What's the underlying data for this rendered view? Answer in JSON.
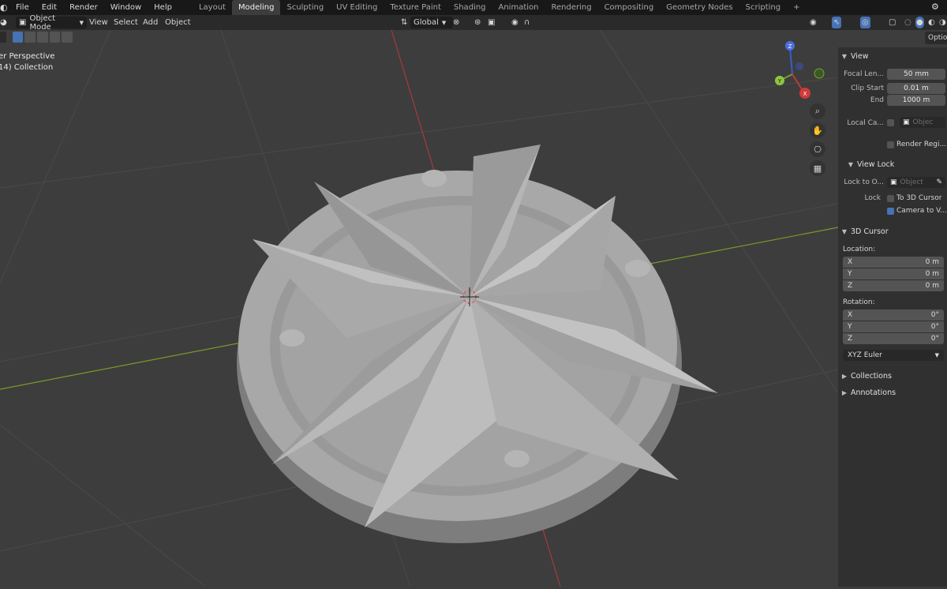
{
  "menu": [
    "File",
    "Edit",
    "Render",
    "Window",
    "Help"
  ],
  "workspaces": [
    "Layout",
    "Modeling",
    "Sculpting",
    "UV Editing",
    "Texture Paint",
    "Shading",
    "Animation",
    "Rendering",
    "Compositing",
    "Geometry Nodes",
    "Scripting"
  ],
  "active_workspace": "Modeling",
  "add_workspace": "+",
  "header": {
    "mode": "Object Mode",
    "view": "View",
    "select": "Select",
    "add": "Add",
    "object": "Object",
    "orientation": "Global"
  },
  "viewport": {
    "perspective_label": "er Perspective",
    "collection_label": "14) Collection"
  },
  "gizmo": {
    "x": "X",
    "y": "Y",
    "z": "Z"
  },
  "options_tab": "Optio",
  "npanel": {
    "view": {
      "title": "View",
      "focal_label": "Focal Len...",
      "focal_value": "50 mm",
      "clip_start_label": "Clip Start",
      "clip_start_value": "0.01 m",
      "end_label": "End",
      "end_value": "1000 m",
      "local_camera_label": "Local Ca...",
      "local_camera_placeholder": "Objec",
      "render_region_label": "Render Regi..."
    },
    "view_lock": {
      "title": "View Lock",
      "lock_to_object_label": "Lock to O...",
      "lock_to_object_placeholder": "Object",
      "lock_label": "Lock",
      "to_3d_cursor_label": "To 3D Cursor",
      "camera_to_view_label": "Camera to V..."
    },
    "cursor": {
      "title": "3D Cursor",
      "location_label": "Location:",
      "loc_x_label": "X",
      "loc_x": "0 m",
      "loc_y_label": "Y",
      "loc_y": "0 m",
      "loc_z_label": "Z",
      "loc_z": "0 m",
      "rotation_label": "Rotation:",
      "rot_x_label": "X",
      "rot_x": "0°",
      "rot_y_label": "Y",
      "rot_y": "0°",
      "rot_z_label": "Z",
      "rot_z": "0°",
      "rotation_mode": "XYZ Euler"
    },
    "collections_title": "Collections",
    "annotations_title": "Annotations"
  },
  "colors": {
    "background": "#3d3d3d",
    "grid": "#4a4a4a",
    "x_axis": "#a63b3b",
    "y_axis": "#7a9a2a",
    "model": "#9a9a9a",
    "accent": "#4772b3"
  }
}
